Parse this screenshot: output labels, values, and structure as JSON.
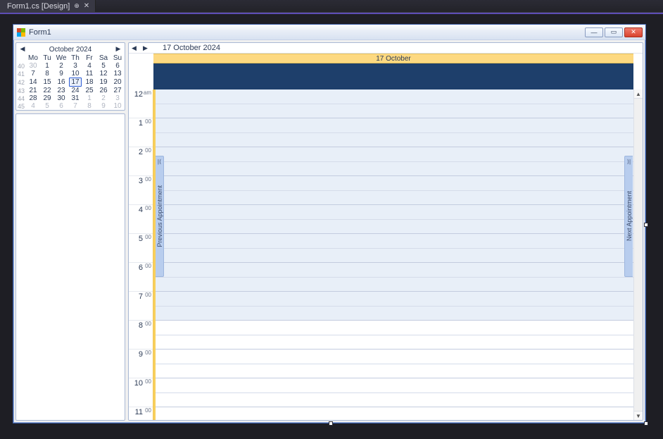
{
  "ide": {
    "tab_label": "Form1.cs [Design]"
  },
  "window": {
    "title": "Form1"
  },
  "dateNav": {
    "title": "October  2024",
    "dow": [
      "Mo",
      "Tu",
      "We",
      "Th",
      "Fr",
      "Sa",
      "Su"
    ],
    "weeks": [
      {
        "wk": "40",
        "days": [
          {
            "d": "30",
            "dim": true
          },
          {
            "d": "1"
          },
          {
            "d": "2"
          },
          {
            "d": "3"
          },
          {
            "d": "4"
          },
          {
            "d": "5"
          },
          {
            "d": "6"
          }
        ]
      },
      {
        "wk": "41",
        "days": [
          {
            "d": "7"
          },
          {
            "d": "8"
          },
          {
            "d": "9"
          },
          {
            "d": "10"
          },
          {
            "d": "11"
          },
          {
            "d": "12"
          },
          {
            "d": "13"
          }
        ]
      },
      {
        "wk": "42",
        "days": [
          {
            "d": "14"
          },
          {
            "d": "15"
          },
          {
            "d": "16"
          },
          {
            "d": "17",
            "sel": true
          },
          {
            "d": "18"
          },
          {
            "d": "19"
          },
          {
            "d": "20"
          }
        ]
      },
      {
        "wk": "43",
        "days": [
          {
            "d": "21"
          },
          {
            "d": "22"
          },
          {
            "d": "23"
          },
          {
            "d": "24"
          },
          {
            "d": "25"
          },
          {
            "d": "26"
          },
          {
            "d": "27"
          }
        ]
      },
      {
        "wk": "44",
        "days": [
          {
            "d": "28"
          },
          {
            "d": "29"
          },
          {
            "d": "30"
          },
          {
            "d": "31"
          },
          {
            "d": "1",
            "dim": true
          },
          {
            "d": "2",
            "dim": true
          },
          {
            "d": "3",
            "dim": true
          }
        ]
      },
      {
        "wk": "45",
        "days": [
          {
            "d": "4",
            "dim": true
          },
          {
            "d": "5",
            "dim": true
          },
          {
            "d": "6",
            "dim": true
          },
          {
            "d": "7",
            "dim": true
          },
          {
            "d": "8",
            "dim": true
          },
          {
            "d": "9",
            "dim": true
          },
          {
            "d": "10",
            "dim": true
          }
        ]
      }
    ]
  },
  "scheduler": {
    "date_label": "17 October 2024",
    "day_header": "17 October",
    "prev_appt": "Previous Appointment",
    "next_appt": "Next Appointment",
    "hours": [
      {
        "h": "12",
        "m": "am"
      },
      {
        "h": "1",
        "m": "00"
      },
      {
        "h": "2",
        "m": "00"
      },
      {
        "h": "3",
        "m": "00"
      },
      {
        "h": "4",
        "m": "00"
      },
      {
        "h": "5",
        "m": "00"
      },
      {
        "h": "6",
        "m": "00"
      },
      {
        "h": "7",
        "m": "00"
      },
      {
        "h": "8",
        "m": "00"
      },
      {
        "h": "9",
        "m": "00"
      },
      {
        "h": "10",
        "m": "00"
      },
      {
        "h": "11",
        "m": "00"
      }
    ],
    "work_start_index": 0,
    "work_end_index": 8
  }
}
